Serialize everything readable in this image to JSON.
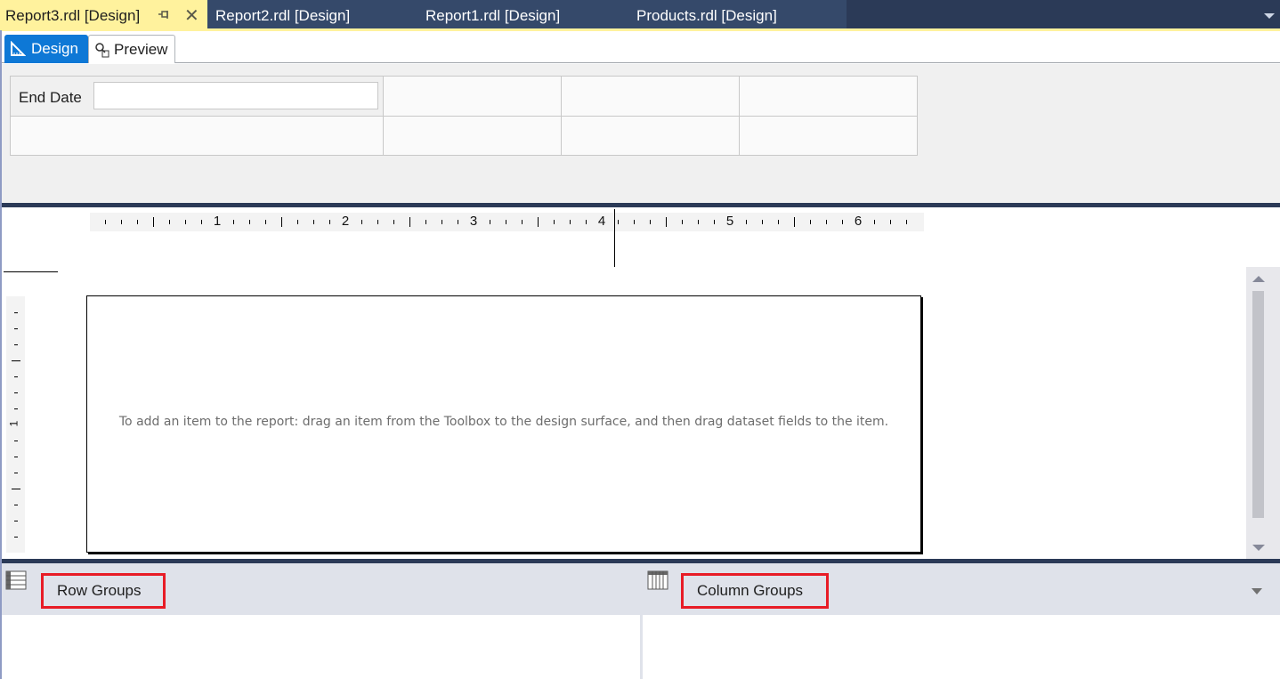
{
  "document_tabs": [
    {
      "label": "Report3.rdl [Design]",
      "active": true
    },
    {
      "label": "Report2.rdl [Design]",
      "active": false
    },
    {
      "label": "Report1.rdl [Design]",
      "active": false
    },
    {
      "label": "Products.rdl [Design]",
      "active": false
    }
  ],
  "view_tabs": {
    "design_label": "Design",
    "preview_label": "Preview",
    "selected": "Design"
  },
  "parameters": {
    "end_date_label": "End Date",
    "end_date_value": ""
  },
  "ruler": {
    "unit": "inches",
    "horizontal_labels": [
      "1",
      "2",
      "3",
      "4",
      "5",
      "6"
    ],
    "vertical_labels": [
      "1"
    ]
  },
  "design_surface": {
    "hint_text": "To add an item to the report: drag an item from the Toolbox to the design surface, and then drag dataset fields to the item."
  },
  "grouping": {
    "row_groups_label": "Row Groups",
    "column_groups_label": "Column Groups",
    "highlight_color": "#e81c26"
  },
  "colors": {
    "active_tab": "#fff29d",
    "tab_bar": "#35496a",
    "design_tab": "#0e78d6",
    "splitter": "#2b3a57"
  }
}
